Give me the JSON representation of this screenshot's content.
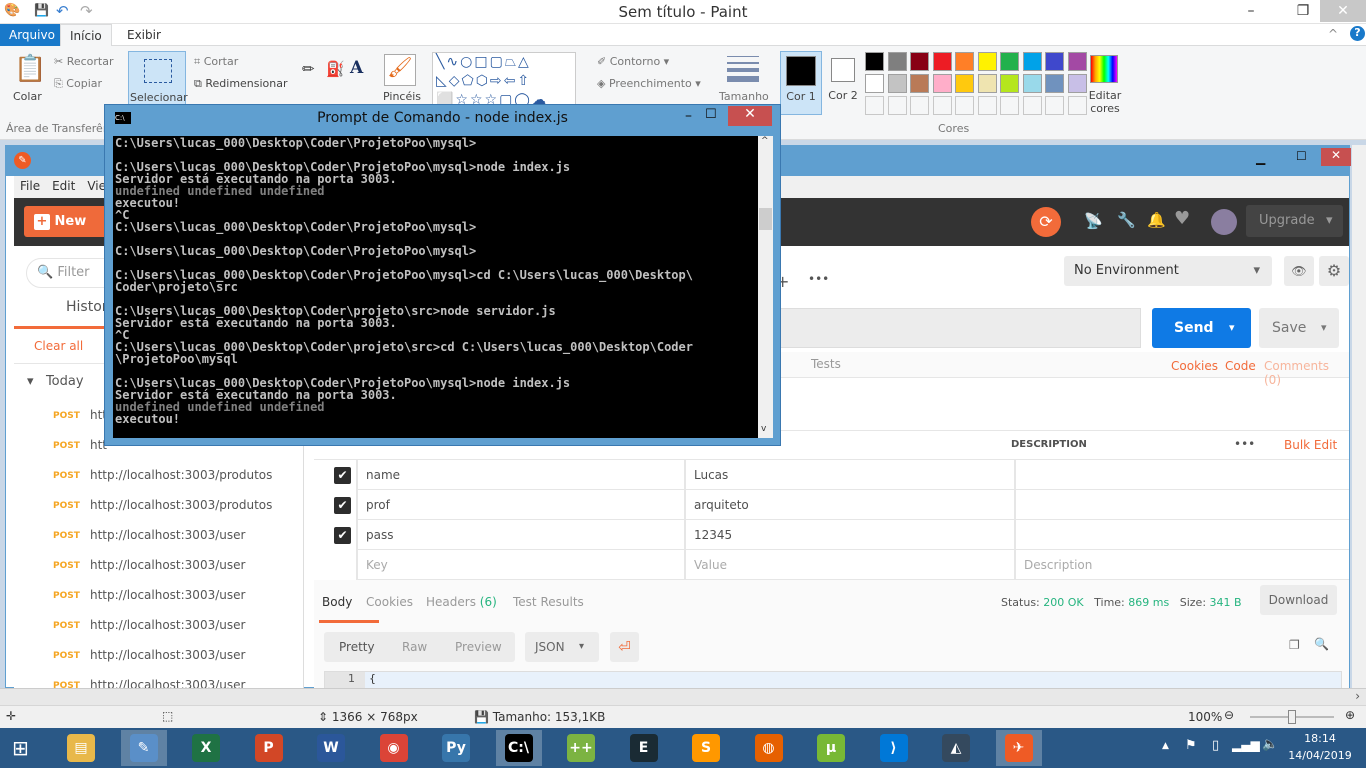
{
  "paint": {
    "title": "Sem título - Paint",
    "tabs": [
      "Arquivo",
      "Início",
      "Exibir"
    ],
    "ribbon": {
      "paste": "Colar",
      "cut": "Recortar",
      "copy": "Copiar",
      "clipboard_group": "Área de Transferência",
      "select": "Selecionar",
      "crop": "Cortar",
      "resize": "Redimensionar",
      "brushes": "Pincéis",
      "outline": "Contorno",
      "fill": "Preenchimento",
      "size": "Tamanho",
      "color1": "Cor 1",
      "color2": "Cor 2",
      "edit_colors": "Editar cores",
      "colors_group": "Cores"
    },
    "palette": [
      "#000000",
      "#7f7f7f",
      "#880015",
      "#ed1c24",
      "#ff7f27",
      "#fff200",
      "#22b14c",
      "#00a2e8",
      "#3f48cc",
      "#a349a4",
      "#ffffff",
      "#c3c3c3",
      "#b97a57",
      "#ffaec9",
      "#ffc90e",
      "#efe4b0",
      "#b5e61d",
      "#99d9ea",
      "#7092be",
      "#c8bfe7"
    ],
    "status": {
      "dimensions": "1366 × 768px",
      "size": "Tamanho: 153,1KB",
      "zoom": "100%"
    }
  },
  "postman": {
    "menu": [
      "File",
      "Edit",
      "View"
    ],
    "new_label": "New",
    "upgrade_label": "Upgrade",
    "filter_placeholder": "Filter",
    "history_tab": "History",
    "clear_all": "Clear all",
    "today": "Today",
    "history": [
      {
        "method": "POST",
        "url": "htt"
      },
      {
        "method": "POST",
        "url": "htt"
      },
      {
        "method": "POST",
        "url": "http://localhost:3003/produtos"
      },
      {
        "method": "POST",
        "url": "http://localhost:3003/produtos"
      },
      {
        "method": "POST",
        "url": "http://localhost:3003/user"
      },
      {
        "method": "POST",
        "url": "http://localhost:3003/user"
      },
      {
        "method": "POST",
        "url": "http://localhost:3003/user"
      },
      {
        "method": "POST",
        "url": "http://localhost:3003/user"
      },
      {
        "method": "POST",
        "url": "http://localhost:3003/user"
      },
      {
        "method": "POST",
        "url": "http://localhost:3003/user"
      }
    ],
    "environment": "No Environment",
    "send": "Send",
    "save": "Save",
    "tests_tab": "Tests",
    "cookies": "Cookies",
    "code": "Code",
    "comments": "Comments (0)",
    "params_header": {
      "description": "DESCRIPTION",
      "bulk_edit": "Bulk Edit"
    },
    "params": [
      {
        "key": "name",
        "value": "Lucas",
        "checked": true
      },
      {
        "key": "prof",
        "value": "arquiteto",
        "checked": true
      },
      {
        "key": "pass",
        "value": "12345",
        "checked": true
      }
    ],
    "placeholders": {
      "key": "Key",
      "value": "Value",
      "description": "Description"
    },
    "response_tabs": [
      "Body",
      "Cookies",
      "Headers (6)",
      "Test Results"
    ],
    "status_label": "Status:",
    "status_value": "200 OK",
    "time_label": "Time:",
    "time_value": "869 ms",
    "size_label": "Size:",
    "size_value": "341 B",
    "download": "Download",
    "view_modes": [
      "Pretty",
      "Raw",
      "Preview"
    ],
    "format": "JSON",
    "line_no": "1",
    "line_text": "{"
  },
  "cmd": {
    "title": "Prompt de Comando - node  index.js",
    "lines": [
      {
        "t": "C:\\Users\\lucas_000\\Desktop\\Coder\\ProjetoPoo\\mysql>",
        "g": false
      },
      {
        "t": "",
        "g": false
      },
      {
        "t": "C:\\Users\\lucas_000\\Desktop\\Coder\\ProjetoPoo\\mysql>node index.js",
        "g": false
      },
      {
        "t": "Servidor está executando na porta 3003.",
        "g": false
      },
      {
        "t": "undefined undefined undefined",
        "g": true
      },
      {
        "t": "executou!",
        "g": false
      },
      {
        "t": "^C",
        "g": false
      },
      {
        "t": "C:\\Users\\lucas_000\\Desktop\\Coder\\ProjetoPoo\\mysql>",
        "g": false
      },
      {
        "t": "",
        "g": false
      },
      {
        "t": "C:\\Users\\lucas_000\\Desktop\\Coder\\ProjetoPoo\\mysql>",
        "g": false
      },
      {
        "t": "",
        "g": false
      },
      {
        "t": "C:\\Users\\lucas_000\\Desktop\\Coder\\ProjetoPoo\\mysql>cd C:\\Users\\lucas_000\\Desktop\\",
        "g": false
      },
      {
        "t": "Coder\\projeto\\src",
        "g": false
      },
      {
        "t": "",
        "g": false
      },
      {
        "t": "C:\\Users\\lucas_000\\Desktop\\Coder\\projeto\\src>node servidor.js",
        "g": false
      },
      {
        "t": "Servidor está executando na porta 3003.",
        "g": false
      },
      {
        "t": "^C",
        "g": false
      },
      {
        "t": "C:\\Users\\lucas_000\\Desktop\\Coder\\projeto\\src>cd C:\\Users\\lucas_000\\Desktop\\Coder",
        "g": false
      },
      {
        "t": "\\ProjetoPoo\\mysql",
        "g": false
      },
      {
        "t": "",
        "g": false
      },
      {
        "t": "C:\\Users\\lucas_000\\Desktop\\Coder\\ProjetoPoo\\mysql>node index.js",
        "g": false
      },
      {
        "t": "Servidor está executando na porta 3003.",
        "g": false
      },
      {
        "t": "undefined undefined undefined",
        "g": true
      },
      {
        "t": "executou!",
        "g": false
      }
    ]
  },
  "taskbar": {
    "apps": [
      {
        "name": "file-explorer",
        "glyph": "▤",
        "color": "#e8b84a"
      },
      {
        "name": "paint",
        "glyph": "✎",
        "color": "#5a8fc8",
        "active": true
      },
      {
        "name": "excel",
        "glyph": "X",
        "color": "#1f7244"
      },
      {
        "name": "powerpoint",
        "glyph": "P",
        "color": "#d24726"
      },
      {
        "name": "word",
        "glyph": "W",
        "color": "#2b579a"
      },
      {
        "name": "chrome",
        "glyph": "◉",
        "color": "#db4437"
      },
      {
        "name": "python",
        "glyph": "Py",
        "color": "#3776ab"
      },
      {
        "name": "command-prompt",
        "glyph": "C:\\",
        "color": "#000000",
        "active": true
      },
      {
        "name": "notepad-plus-plus",
        "glyph": "++",
        "color": "#7cb342"
      },
      {
        "name": "eclipse-terminal",
        "glyph": "E",
        "color": "#1a2b34"
      },
      {
        "name": "sublime-text",
        "glyph": "S",
        "color": "#ff9800"
      },
      {
        "name": "firefox",
        "glyph": "◍",
        "color": "#e66000"
      },
      {
        "name": "utorrent",
        "glyph": "µ",
        "color": "#78b835"
      },
      {
        "name": "vscode",
        "glyph": "⟩",
        "color": "#0078d7"
      },
      {
        "name": "mysql-workbench",
        "glyph": "◭",
        "color": "#34495e"
      },
      {
        "name": "postman",
        "glyph": "✈",
        "color": "#ef5b25",
        "active": true
      }
    ],
    "time": "18:14",
    "date": "14/04/2019"
  }
}
